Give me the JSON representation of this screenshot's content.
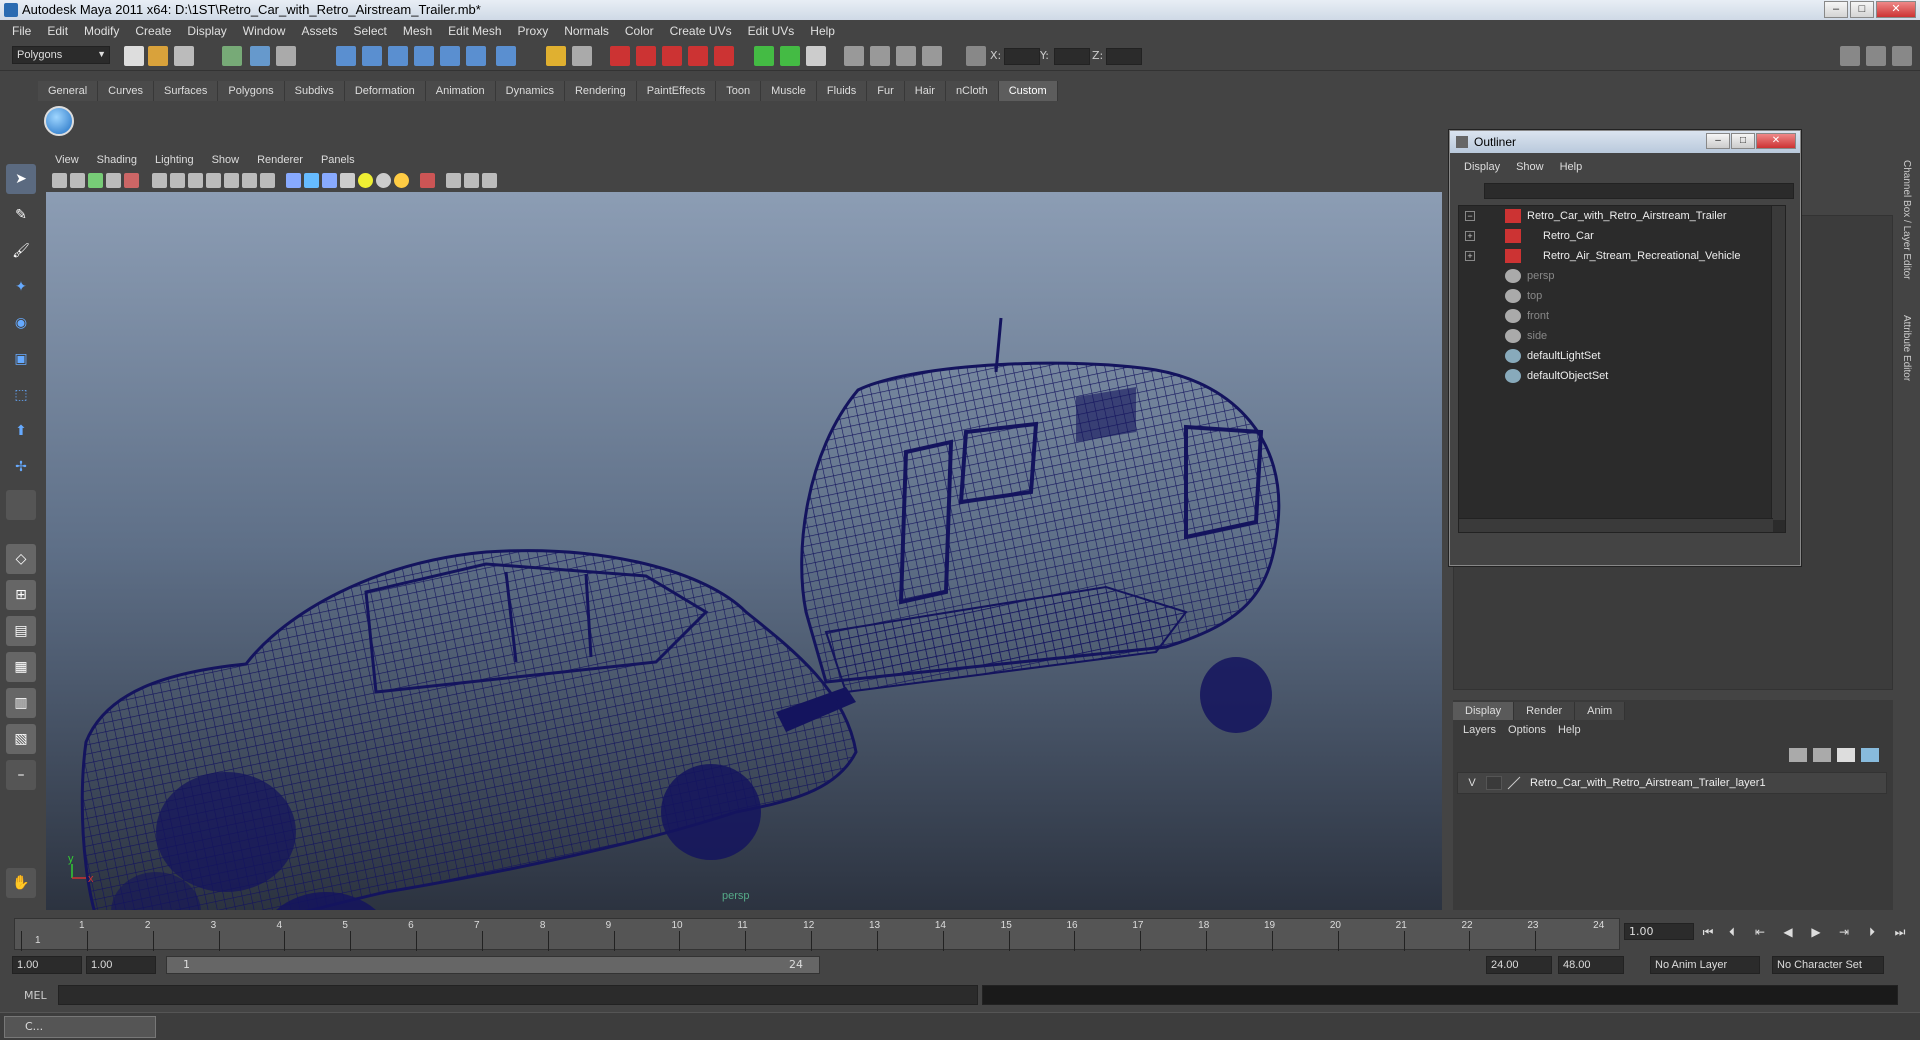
{
  "title": "Autodesk Maya 2011 x64: D:\\1ST\\Retro_Car_with_Retro_Airstream_Trailer.mb*",
  "menu": [
    "File",
    "Edit",
    "Modify",
    "Create",
    "Display",
    "Window",
    "Assets",
    "Select",
    "Mesh",
    "Edit Mesh",
    "Proxy",
    "Normals",
    "Color",
    "Create UVs",
    "Edit UVs",
    "Help"
  ],
  "status": {
    "mode": "Polygons",
    "x_label": "X:",
    "y_label": "Y:",
    "z_label": "Z:"
  },
  "shelf_tabs": [
    "General",
    "Curves",
    "Surfaces",
    "Polygons",
    "Subdivs",
    "Deformation",
    "Animation",
    "Dynamics",
    "Rendering",
    "PaintEffects",
    "Toon",
    "Muscle",
    "Fluids",
    "Fur",
    "Hair",
    "nCloth",
    "Custom"
  ],
  "shelf_active": "Custom",
  "viewport": {
    "menu": [
      "View",
      "Shading",
      "Lighting",
      "Show",
      "Renderer",
      "Panels"
    ],
    "camera_label": "persp",
    "axis_y": "y",
    "axis_x": "x"
  },
  "outliner": {
    "title": "Outliner",
    "menu": [
      "Display",
      "Show",
      "Help"
    ],
    "items": [
      {
        "label": "Retro_Car_with_Retro_Airstream_Trailer",
        "expander": "−",
        "icon": "mesh-transform-icon",
        "dim": false
      },
      {
        "label": "Retro_Car",
        "expander": "+",
        "icon": "mesh-transform-icon",
        "dim": false
      },
      {
        "label": "Retro_Air_Stream_Recreational_Vehicle",
        "expander": "+",
        "icon": "mesh-transform-icon",
        "dim": false
      },
      {
        "label": "persp",
        "expander": "",
        "icon": "camera-icon",
        "dim": true
      },
      {
        "label": "top",
        "expander": "",
        "icon": "camera-icon",
        "dim": true
      },
      {
        "label": "front",
        "expander": "",
        "icon": "camera-icon",
        "dim": true
      },
      {
        "label": "side",
        "expander": "",
        "icon": "camera-icon",
        "dim": true
      },
      {
        "label": "defaultLightSet",
        "expander": "",
        "icon": "set-icon",
        "dim": false
      },
      {
        "label": "defaultObjectSet",
        "expander": "",
        "icon": "set-icon",
        "dim": false
      }
    ]
  },
  "side_tabs": [
    "Channel Box / Layer Editor",
    "Attribute Editor"
  ],
  "layers": {
    "tabs": [
      "Display",
      "Render",
      "Anim"
    ],
    "active_tab": "Display",
    "menu": [
      "Layers",
      "Options",
      "Help"
    ],
    "rows": [
      {
        "visible": "V",
        "name": "Retro_Car_with_Retro_Airstream_Trailer_layer1"
      }
    ]
  },
  "timeline": {
    "ticks": [
      "1",
      "2",
      "3",
      "4",
      "5",
      "6",
      "7",
      "8",
      "9",
      "10",
      "11",
      "12",
      "13",
      "14",
      "15",
      "16",
      "17",
      "18",
      "19",
      "20",
      "21",
      "22",
      "23",
      "24"
    ],
    "current_marker": "1",
    "current_frame": "1.00"
  },
  "range": {
    "start": "1.00",
    "playback_start": "1.00",
    "slider_start": "1",
    "slider_end": "24",
    "playback_end": "24.00",
    "end": "48.00",
    "anim_layer": "No Anim Layer",
    "character_set": "No Character Set"
  },
  "command": {
    "label": "MEL"
  },
  "taskbar": {
    "item": "C..."
  },
  "colors": {
    "wireframe": "#14145e",
    "accent": "#2a6bb1"
  }
}
